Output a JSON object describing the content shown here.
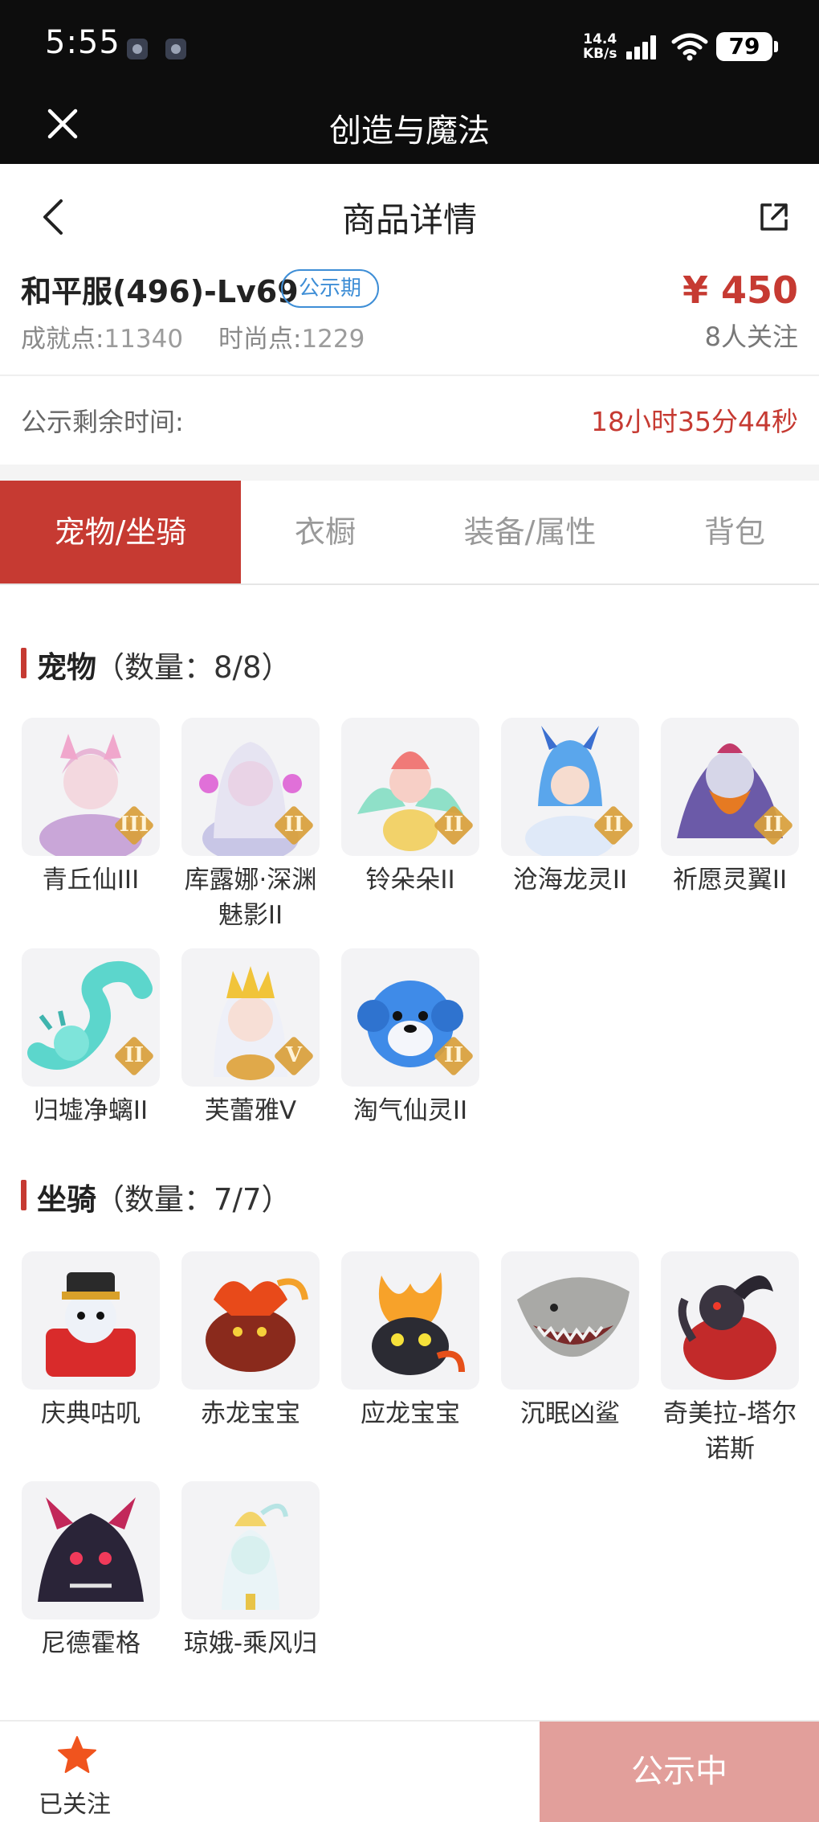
{
  "status_bar": {
    "time": "5:55",
    "speed_value": "14.4",
    "speed_unit": "KB/s",
    "battery": "79"
  },
  "webview": {
    "title": "创造与魔法"
  },
  "nav": {
    "title": "商品详情"
  },
  "product": {
    "name": "和平服(496)-Lv69",
    "badge": "公示期",
    "price": "¥ 450",
    "followers": "8人关注",
    "achievement_label": "成就点:",
    "achievement_value": "11340",
    "fashion_label": "时尚点:",
    "fashion_value": "1229",
    "remaining_label": "公示剩余时间:",
    "remaining_value": "18小时35分44秒"
  },
  "tabs": [
    {
      "label": "宠物/坐骑"
    },
    {
      "label": "衣橱"
    },
    {
      "label": "装备/属性"
    },
    {
      "label": "背包"
    }
  ],
  "pets": {
    "title": "宠物",
    "count": "（数量：8/8）",
    "items": [
      {
        "name": "青丘仙III",
        "tier": "III"
      },
      {
        "name": "库露娜·深渊魅影II",
        "tier": "II"
      },
      {
        "name": "铃朵朵II",
        "tier": "II"
      },
      {
        "name": "沧海龙灵II",
        "tier": "II"
      },
      {
        "name": "祈愿灵翼II",
        "tier": "II"
      },
      {
        "name": "归墟净螭II",
        "tier": "II"
      },
      {
        "name": "芙蕾雅V",
        "tier": "V"
      },
      {
        "name": "淘气仙灵II",
        "tier": "II"
      }
    ]
  },
  "mounts": {
    "title": "坐骑",
    "count": "（数量：7/7）",
    "items": [
      {
        "name": "庆典咕叽"
      },
      {
        "name": "赤龙宝宝"
      },
      {
        "name": "应龙宝宝"
      },
      {
        "name": "沉眠凶鲨"
      },
      {
        "name": "奇美拉-塔尔诺斯"
      },
      {
        "name": "尼德霍格"
      },
      {
        "name": "琼娥-乘风归"
      }
    ]
  },
  "bottom": {
    "follow_label": "已关注",
    "status_button": "公示中"
  },
  "colors": {
    "accent": "#c63a32",
    "badge_blue": "#3e8ed6",
    "button_disabled": "#e29f9b",
    "tier_gold": "#d9a03a"
  }
}
